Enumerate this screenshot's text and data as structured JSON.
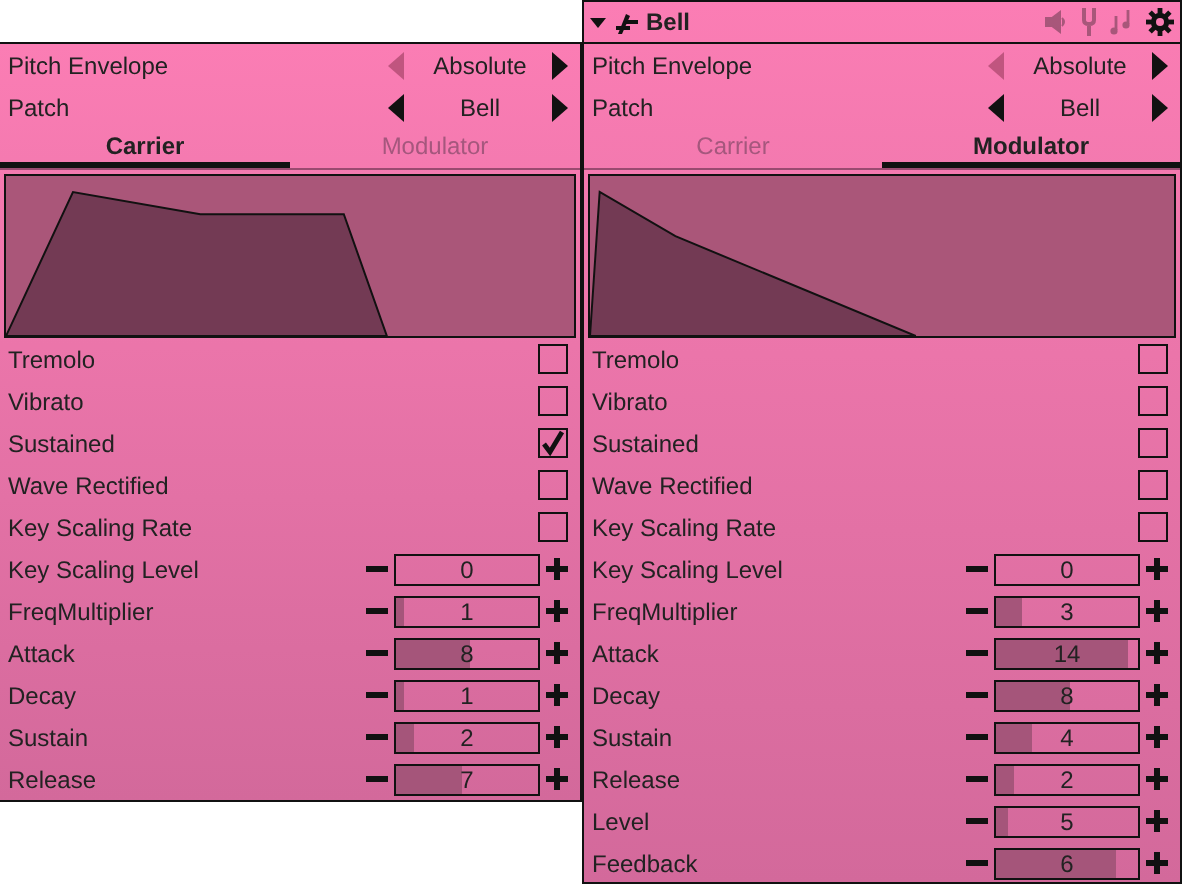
{
  "panels": [
    {
      "pickers": [
        {
          "label": "Pitch Envelope",
          "value": "Absolute",
          "prev_disabled": true
        },
        {
          "label": "Patch",
          "value": "Bell",
          "prev_disabled": false
        }
      ],
      "tabs": [
        {
          "label": "Carrier",
          "selected": true
        },
        {
          "label": "Modulator",
          "selected": false
        }
      ],
      "rows": [
        {
          "kind": "toggle",
          "label": "Tremolo",
          "checked": false
        },
        {
          "kind": "toggle",
          "label": "Vibrato",
          "checked": false
        },
        {
          "kind": "toggle",
          "label": "Sustained",
          "checked": true
        },
        {
          "kind": "toggle",
          "label": "Wave Rectified",
          "checked": false
        },
        {
          "kind": "toggle",
          "label": "Key Scaling Rate",
          "checked": false
        },
        {
          "kind": "slider",
          "label": "Key Scaling Level",
          "value": "0",
          "level": 0
        },
        {
          "kind": "slider",
          "label": "FreqMultiplier",
          "value": "1",
          "level": 0.06
        },
        {
          "kind": "slider",
          "label": "Attack",
          "value": "8",
          "level": 0.52
        },
        {
          "kind": "slider",
          "label": "Decay",
          "value": "1",
          "level": 0.06
        },
        {
          "kind": "slider",
          "label": "Sustain",
          "value": "2",
          "level": 0.13
        },
        {
          "kind": "slider",
          "label": "Release",
          "value": "7",
          "level": 0.46
        }
      ]
    },
    {
      "header": {
        "title": "Bell"
      },
      "pickers": [
        {
          "label": "Pitch Envelope",
          "value": "Absolute",
          "prev_disabled": true
        },
        {
          "label": "Patch",
          "value": "Bell",
          "prev_disabled": false
        }
      ],
      "tabs": [
        {
          "label": "Carrier",
          "selected": false
        },
        {
          "label": "Modulator",
          "selected": true
        }
      ],
      "rows": [
        {
          "kind": "toggle",
          "label": "Tremolo",
          "checked": false
        },
        {
          "kind": "toggle",
          "label": "Vibrato",
          "checked": false
        },
        {
          "kind": "toggle",
          "label": "Sustained",
          "checked": false
        },
        {
          "kind": "toggle",
          "label": "Wave Rectified",
          "checked": false
        },
        {
          "kind": "toggle",
          "label": "Key Scaling Rate",
          "checked": false
        },
        {
          "kind": "slider",
          "label": "Key Scaling Level",
          "value": "0",
          "level": 0
        },
        {
          "kind": "slider",
          "label": "FreqMultiplier",
          "value": "3",
          "level": 0.19
        },
        {
          "kind": "slider",
          "label": "Attack",
          "value": "14",
          "level": 0.93
        },
        {
          "kind": "slider",
          "label": "Decay",
          "value": "8",
          "level": 0.52
        },
        {
          "kind": "slider",
          "label": "Sustain",
          "value": "4",
          "level": 0.26
        },
        {
          "kind": "slider",
          "label": "Release",
          "value": "2",
          "level": 0.13
        },
        {
          "kind": "slider",
          "label": "Level",
          "value": "5",
          "level": 0.08
        },
        {
          "kind": "slider",
          "label": "Feedback",
          "value": "6",
          "level": 0.85
        }
      ]
    }
  ]
}
